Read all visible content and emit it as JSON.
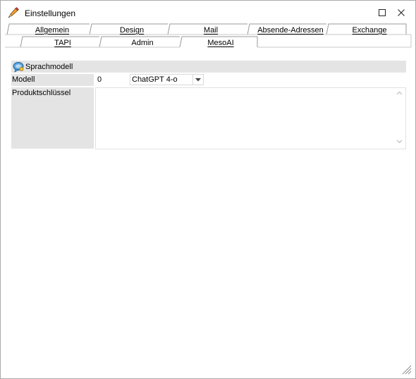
{
  "window": {
    "title": "Einstellungen",
    "icon": "pencil-icon"
  },
  "tabs": {
    "row1": [
      "Allgemein",
      "Design",
      "Mail",
      "Absende-Adressen",
      "Exchange"
    ],
    "row2": [
      "TAPI",
      "Admin",
      "MesoAI"
    ],
    "active": "MesoAI"
  },
  "section": {
    "title": "Sprachmodell",
    "icon": "chat-bubble-icon"
  },
  "form": {
    "modell_label": "Modell",
    "modell_code": "0",
    "modell_value": "ChatGPT 4-o",
    "key_label": "Produktschlüssel",
    "key_value": ""
  },
  "colors": {
    "label_background": "#e4e4e4",
    "window_border": "#aaaaaa"
  }
}
